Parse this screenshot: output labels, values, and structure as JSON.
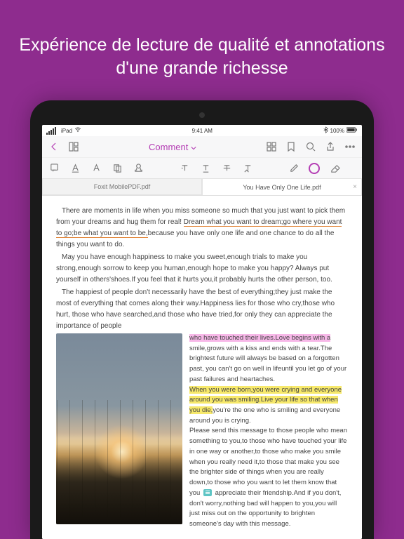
{
  "marketing": {
    "headline": "Expérience de lecture de qualité et annotations d'une grande richesse"
  },
  "statusBar": {
    "carrier": "iPad",
    "wifi": "wifi-icon",
    "time": "9:41 AM",
    "bluetooth": "bt-icon",
    "battery": "100%"
  },
  "toolbar": {
    "title": "Comment"
  },
  "tabs": [
    {
      "label": "Foxit MobilePDF.pdf",
      "active": false
    },
    {
      "label": "You Have Only One Life.pdf",
      "active": true
    }
  ],
  "document": {
    "p1_a": "There are moments in life when you miss someone so much that you just want to pick them from your dreams and hug them for real! ",
    "p1_u": "Dream what you want to dream;go where you want to go;be what you want to be,",
    "p1_b": "because you have only one life and one chance to do all the things you want to do.",
    "p2": "May you have enough happiness to make you sweet,enough trials to make you strong,enough sorrow to keep you human,enough hope to make you happy? Always put yourself in others'shoes.If you feel that it hurts you,it probably hurts the other person, too.",
    "p3": "The happiest of people don't necessarily have the best of everything;they just make the most of everything that comes along their way.Happiness lies for those who cry,those who hurt, those who have searched,and those who have tried,for only they can appreciate the importance of people",
    "r1_hl": "who have touched their lives.Love begins with a",
    "r1_tail": " smile,grows with a kiss and ends with a tear.The brightest future will always be based on a forgotten past, you can't go on well in lifeuntil you let go of your past failures and heartaches.",
    "r2_hl": "When you were born,you were crying and everyone around you was smiling.Live your life so that when you die,",
    "r2_tail": "you're the one who is smiling and everyone around you is crying.",
    "r3_a": "Please send this message to those people who mean something to you,to those who have touched your life in one way or another,to those who make you smile when you really need it,to those that make you see the brighter side of things when you are really down,to those who you want to let them know that you ",
    "r3_b": " appreciate their friendship.And if you don't, don't worry,nothing bad will happen to you,you will just miss out on the opportunity to brighten someone's day with this message."
  }
}
